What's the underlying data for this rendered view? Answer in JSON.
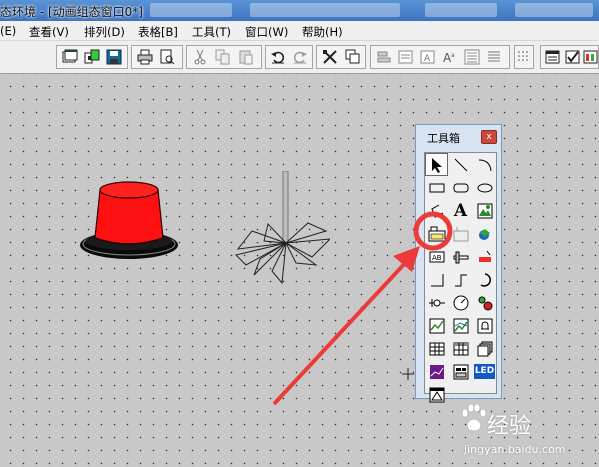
{
  "window": {
    "title": "态环境 - [动画组态窗口0*]"
  },
  "menu": [
    {
      "label": "(E)",
      "id": "edit"
    },
    {
      "label": "查看(V)",
      "id": "view"
    },
    {
      "label": "排列(D)",
      "id": "arrange"
    },
    {
      "label": "表格[B]",
      "id": "table"
    },
    {
      "label": "工具(T)",
      "id": "tools"
    },
    {
      "label": "窗口(W)",
      "id": "window"
    },
    {
      "label": "帮助(H)",
      "id": "help"
    }
  ],
  "toolbox": {
    "title": "工具箱",
    "close_glyph": "x",
    "tools": [
      "pointer-tool",
      "line-tool",
      "arc-tool",
      "rectangle-tool",
      "rounded-rectangle-tool",
      "ellipse-tool",
      "polyline-tool",
      "label-tool",
      "bitmap-tool",
      "input-output-tool",
      "flow-block-tool",
      "insert-element-tool",
      "lamp-tool",
      "slider-tool",
      "alarm-display-tool",
      "line-segment-tool",
      "polyline-connector-tool",
      "rotary-tool",
      "scale-tool",
      "gauge-tool",
      "pushbutton-tool",
      "trend-curve-tool",
      "history-curve-tool",
      "alarm-tool",
      "custom-window-tool",
      "grid-table-tool",
      "history-table-tool",
      "curve-chart-tool",
      "combo-box-tool",
      "led-tool",
      "capture-tool"
    ],
    "led_text": "LED",
    "label_glyph": "A"
  },
  "watermark": {
    "name": "经验",
    "url": "jingyan.baidu.com"
  },
  "colors": {
    "lamp_red": "#ff1010",
    "annotation_red": "#ec3a3a",
    "title_bar": "#4a84cc",
    "canvas": "#c8c8c8"
  }
}
